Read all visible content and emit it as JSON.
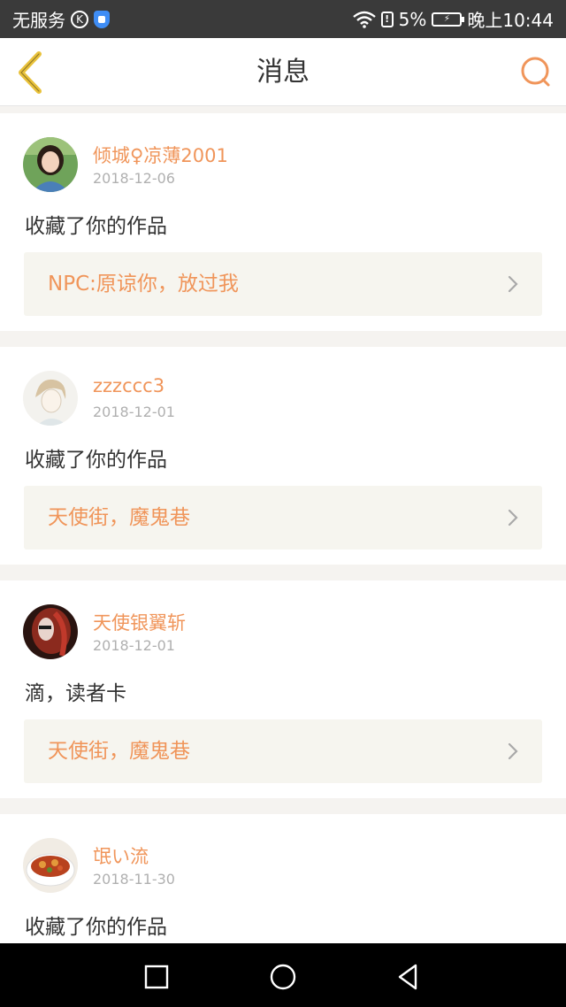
{
  "status_bar": {
    "carrier": "无服务",
    "k_icon": "K",
    "battery": "5%",
    "time": "晚上10:44",
    "icons": [
      "k-circle-icon",
      "shield-icon",
      "wifi-icon",
      "alert-icon",
      "battery-charging-icon"
    ]
  },
  "header": {
    "title": "消息",
    "back_icon": "chevron-left-icon",
    "search_icon": "search-icon",
    "accent": "#f0955a",
    "back_color": "#e9c23b"
  },
  "messages": [
    {
      "user": "倾城♀凉薄2001",
      "date": "2018-12-06",
      "action": "收藏了你的作品",
      "work": "NPC:原谅你，放过我",
      "avatar": "avatar-girl"
    },
    {
      "user": "zzzccc3",
      "date": "2018-12-01",
      "action": "收藏了你的作品",
      "work": "天使街，魔鬼巷",
      "avatar": "avatar-sketch"
    },
    {
      "user": "天使银翼斩",
      "date": "2018-12-01",
      "action": "滴，读者卡",
      "work": "天使街，魔鬼巷",
      "avatar": "avatar-redhair"
    },
    {
      "user": "氓い流",
      "date": "2018-11-30",
      "action": "收藏了你的作品",
      "work": "",
      "avatar": "avatar-food"
    }
  ],
  "nav_bar": {
    "icons": [
      "square-recent-icon",
      "circle-home-icon",
      "triangle-back-icon"
    ]
  }
}
